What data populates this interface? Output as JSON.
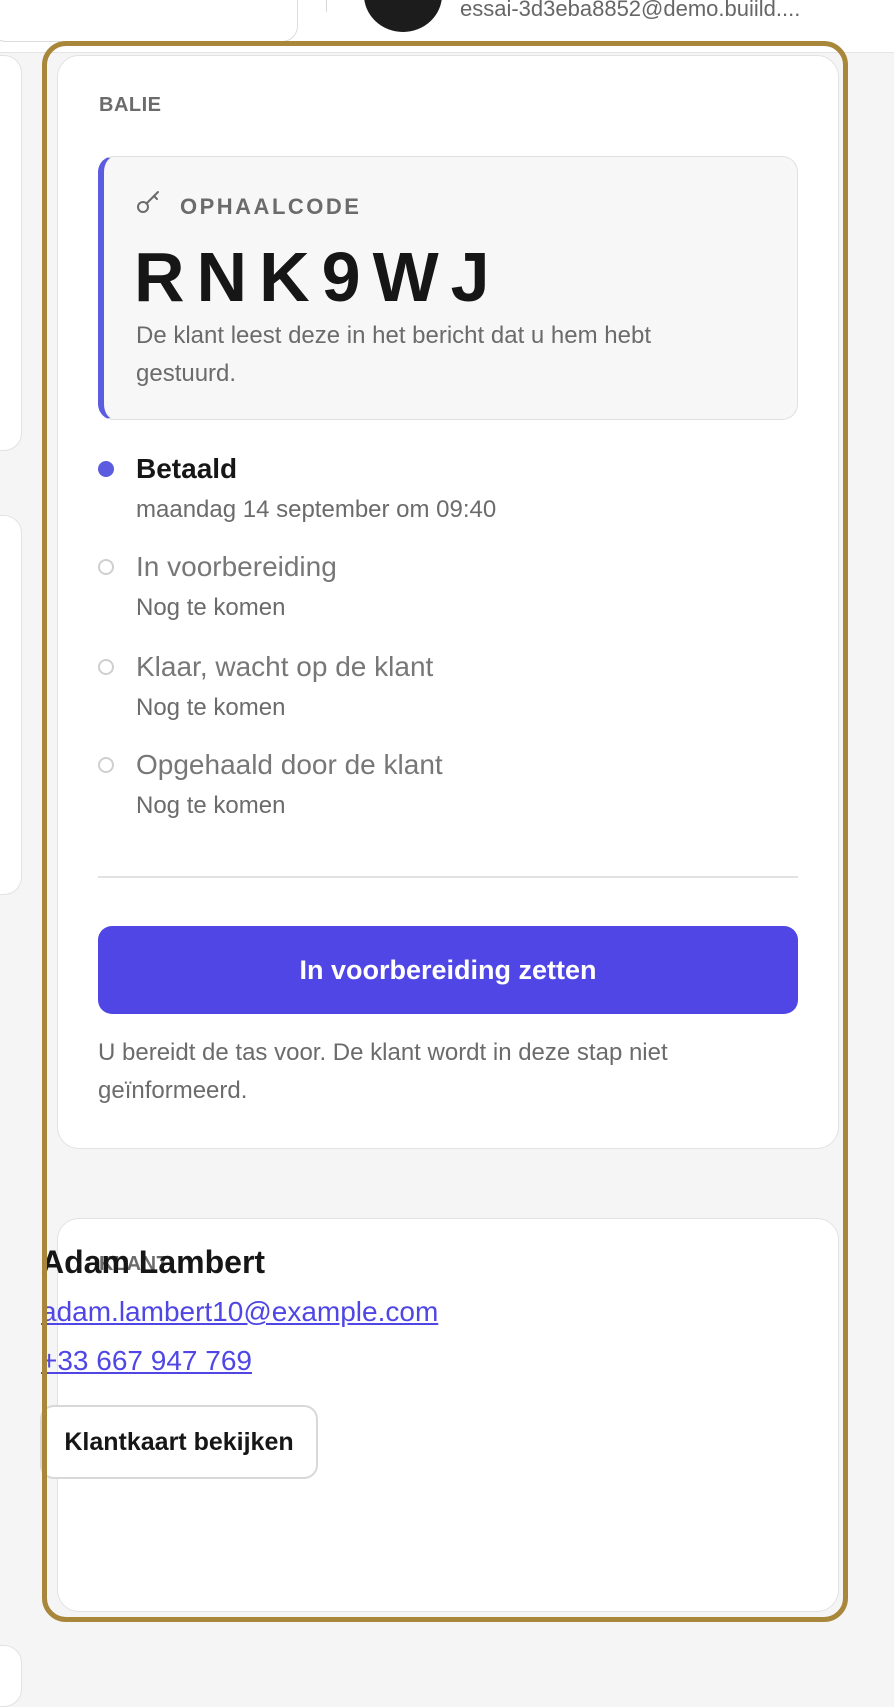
{
  "topbar": {
    "user_email": "essai-3d3eba8852@demo.buiild...."
  },
  "counter": {
    "section_label": "BALIE",
    "pickup_code": {
      "label": "OPHAALCODE",
      "value": "RNK9WJ",
      "description": "De klant leest deze in het bericht dat u hem hebt gestuurd."
    },
    "steps": [
      {
        "title": "Betaald",
        "subtitle": "maandag 14 september om 09:40",
        "status": "done"
      },
      {
        "title": "In voorbereiding",
        "subtitle": "Nog te komen",
        "status": "todo"
      },
      {
        "title": "Klaar, wacht op de klant",
        "subtitle": "Nog te komen",
        "status": "todo"
      },
      {
        "title": "Opgehaald door de klant",
        "subtitle": "Nog te komen",
        "status": "todo"
      }
    ],
    "primary_action_label": "In voorbereiding zetten",
    "action_note": "U bereidt de tas voor. De klant wordt in deze stap niet geïnformeerd."
  },
  "customer": {
    "section_label": "KLANT",
    "name": "Adam Lambert",
    "email": "adam.lambert10@example.com",
    "phone": "+33 667 947 769",
    "view_card_label": "Klantkaart bekijken"
  },
  "colors": {
    "accent": "#4f46e5",
    "step_done": "#5b5ce0",
    "highlight_frame": "#a8863a"
  }
}
